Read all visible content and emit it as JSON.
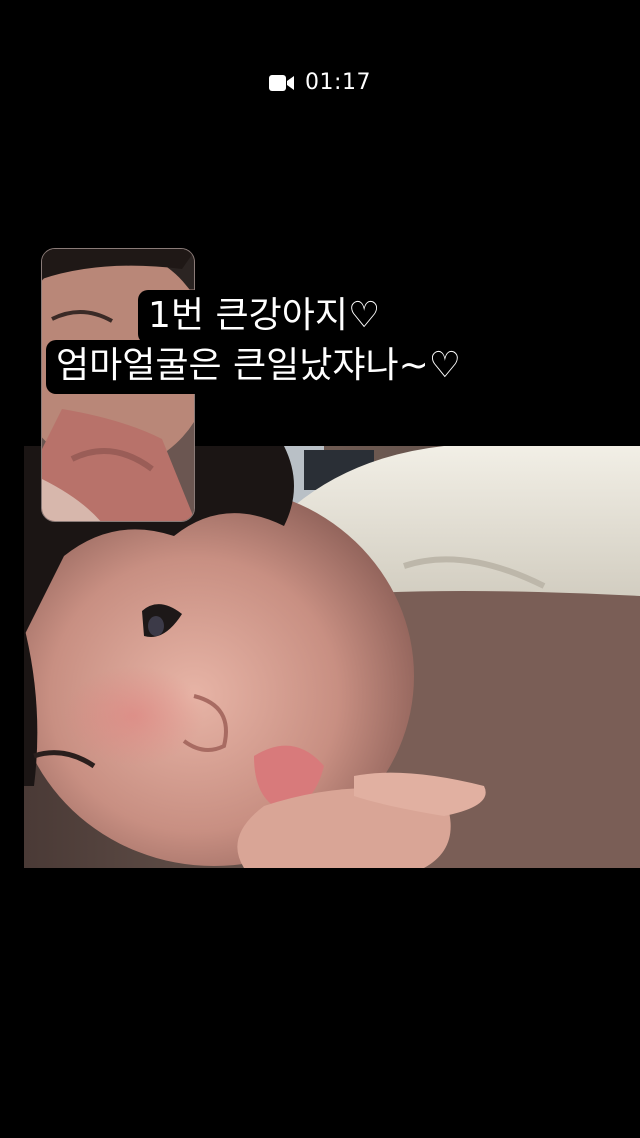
{
  "call": {
    "timer": "01:17",
    "status_icon": "video-camera-icon"
  },
  "caption": {
    "line1": "1번 큰강아지♡",
    "line2": "엄마얼굴은 큰일났쟈나~♡"
  },
  "colors": {
    "background": "#000000",
    "text": "#ffffff"
  }
}
